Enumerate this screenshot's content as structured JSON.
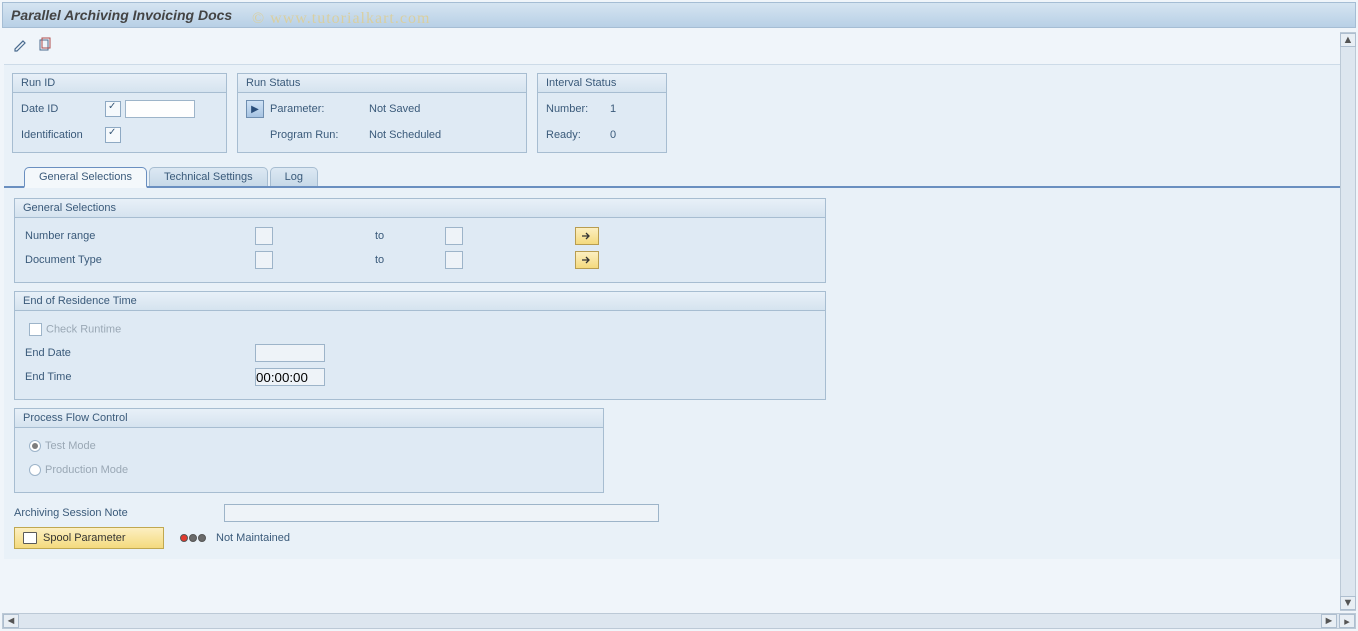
{
  "title": "Parallel Archiving Invoicing Docs",
  "watermark": "© www.tutorialkart.com",
  "run_id": {
    "header": "Run ID",
    "date_id_label": "Date ID",
    "identification_label": "Identification"
  },
  "run_status": {
    "header": "Run Status",
    "parameter_label": "Parameter:",
    "parameter_value": "Not Saved",
    "program_run_label": "Program Run:",
    "program_run_value": "Not Scheduled"
  },
  "interval_status": {
    "header": "Interval Status",
    "number_label": "Number:",
    "number_value": "1",
    "ready_label": "Ready:",
    "ready_value": "0"
  },
  "tabs": {
    "general": "General Selections",
    "technical": "Technical Settings",
    "log": "Log"
  },
  "general_selections": {
    "header": "General Selections",
    "number_range_label": "Number range",
    "document_type_label": "Document Type",
    "to_label": "to"
  },
  "end_of_residence": {
    "header": "End of Residence Time",
    "check_runtime_label": "Check Runtime",
    "end_date_label": "End Date",
    "end_time_label": "End Time",
    "end_time_value": "00:00:00"
  },
  "process_flow": {
    "header": "Process Flow Control",
    "test_mode_label": "Test Mode",
    "production_mode_label": "Production Mode"
  },
  "archiving_session_note_label": "Archiving Session Note",
  "spool_parameter_label": "Spool Parameter",
  "not_maintained_label": "Not Maintained"
}
